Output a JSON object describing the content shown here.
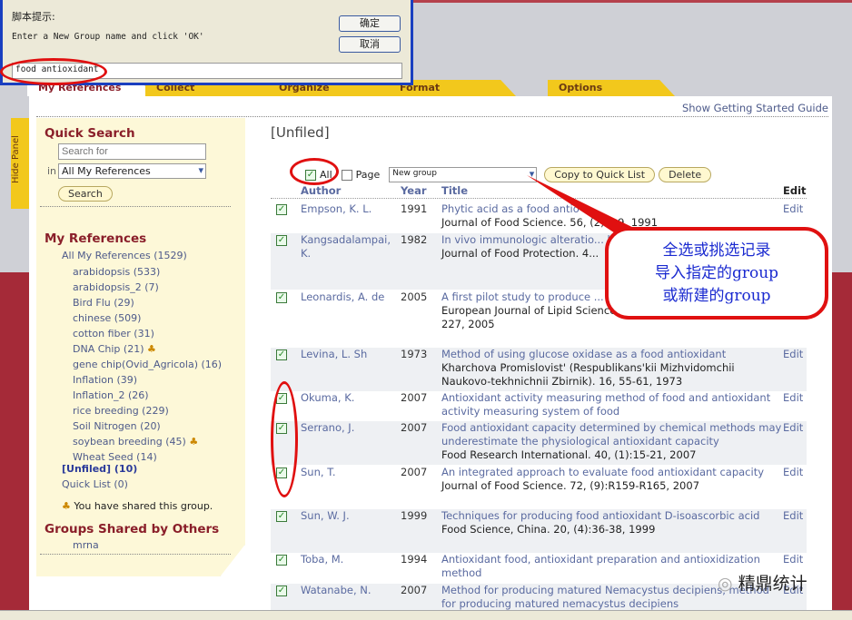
{
  "dialog": {
    "title_label": "脚本提示:",
    "prompt": "Enter a New Group name and click 'OK'",
    "ok": "确定",
    "cancel": "取消",
    "value": "food antioxidant"
  },
  "tabs": [
    "My References",
    "Collect",
    "Organize",
    "Format",
    "Options"
  ],
  "guide_link": "Show Getting Started Guide",
  "hide_panel": "Hide Panel",
  "sidebar": {
    "quick_search": "Quick Search",
    "search_placeholder": "Search for",
    "in_label": "in",
    "scope": "All My References",
    "search_btn": "Search",
    "my_refs": "My References",
    "all": "All My References (1529)",
    "groups": [
      {
        "label": "arabidopsis (533)",
        "shared": false
      },
      {
        "label": "arabidopsis_2 (7)",
        "shared": false
      },
      {
        "label": "Bird Flu (29)",
        "shared": false
      },
      {
        "label": "chinese (509)",
        "shared": false
      },
      {
        "label": "cotton fiber (31)",
        "shared": false
      },
      {
        "label": "DNA Chip (21)",
        "shared": true
      },
      {
        "label": "gene chip(Ovid_Agricola) (16)",
        "shared": false
      },
      {
        "label": "Inflation (39)",
        "shared": false
      },
      {
        "label": "Inflation_2 (26)",
        "shared": false
      },
      {
        "label": "rice breeding (229)",
        "shared": false
      },
      {
        "label": "Soil Nitrogen (20)",
        "shared": false
      },
      {
        "label": "soybean breeding (45)",
        "shared": true
      },
      {
        "label": "Wheat Seed (14)",
        "shared": false
      }
    ],
    "unfiled": "[Unfiled] (10)",
    "quick_list": "Quick List (0)",
    "shared_note": "You have shared this group.",
    "shared_by_others": "Groups Shared by Others",
    "others": [
      "mrna"
    ]
  },
  "main": {
    "heading": "[Unfiled]",
    "toolbar": {
      "all": "All",
      "all_checked": true,
      "page": "Page",
      "page_checked": false,
      "group_select": "New group",
      "copy": "Copy to Quick List",
      "delete": "Delete"
    },
    "columns": {
      "author": "Author",
      "year": "Year",
      "title": "Title",
      "edit": "Edit"
    },
    "rows": [
      {
        "author": "Empson, K. L.",
        "year": "1991",
        "title": "Phytic acid as a food antio",
        "source": "Journal of Food Science. 56, (2) ...9, 1991",
        "edit": "Edit"
      },
      {
        "author": "Kangsadalampai, K.",
        "year": "1982",
        "title": "In vivo immunologic alteratio... butylated hydroxyanisole (BH...",
        "source": "Journal of Food Protection. 4...",
        "edit": ""
      },
      {
        "author": "Leonardis, A. de",
        "year": "2005",
        "title": "A first pilot study to produce ... sunflower seed shells (Helian...",
        "source": "European Journal of Lipid Science & Technology. 107, (4):220-227, 2005",
        "edit": ""
      },
      {
        "author": "Levina, L. Sh",
        "year": "1973",
        "title": "Method of using glucose oxidase as a food antioxidant",
        "source": "Kharchova Promislovist' (Respublikans'kii Mizhvidomchii Naukovo-tekhnichnii Zbirnik). 16, 55-61, 1973",
        "edit": "Edit"
      },
      {
        "author": "Okuma, K.",
        "year": "2007",
        "title": "Antioxidant activity measuring method of food and antioxidant activity measuring system of food",
        "source": "",
        "edit": "Edit"
      },
      {
        "author": "Serrano, J.",
        "year": "2007",
        "title": "Food antioxidant capacity determined by chemical methods may underestimate the physiological antioxidant capacity",
        "source": "Food Research International. 40, (1):15-21, 2007",
        "edit": "Edit"
      },
      {
        "author": "Sun, T.",
        "year": "2007",
        "title": "An integrated approach to evaluate food antioxidant capacity",
        "source": "Journal of Food Science. 72, (9):R159-R165, 2007",
        "edit": "Edit"
      },
      {
        "author": "Sun, W. J.",
        "year": "1999",
        "title": "Techniques for producing food antioxidant D-isoascorbic acid",
        "source": "Food Science, China. 20, (4):36-38, 1999",
        "edit": "Edit"
      },
      {
        "author": "Toba, M.",
        "year": "1994",
        "title": "Antioxidant food, antioxidant preparation and antioxidization method",
        "source": "",
        "edit": "Edit"
      },
      {
        "author": "Watanabe, N.",
        "year": "2007",
        "title": "Method for producing matured Nemacystus decipiens, method for producing matured nemacystus decipiens",
        "source": "",
        "edit": "Edit"
      }
    ]
  },
  "callout": {
    "line1": "全选或挑选记录",
    "line2": "导入指定的group",
    "line3": "或新建的group"
  },
  "watermark": "精鼎统计",
  "colors": {
    "annotation": "#e01010",
    "tab": "#f2c81c",
    "band": "#a52a38",
    "link": "#5a6aa0"
  }
}
